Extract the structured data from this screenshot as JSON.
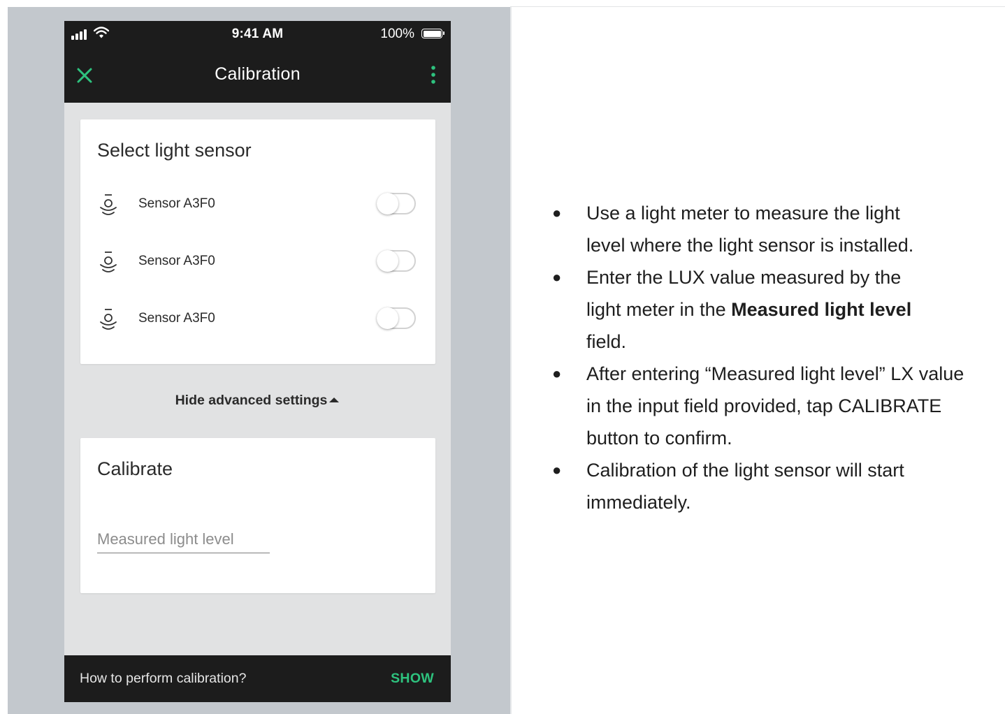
{
  "colors": {
    "accent": "#2ec27e",
    "dark_bar": "#1c1c1c",
    "screen_bg": "#e1e2e3",
    "panel_bg": "#c3c8cd"
  },
  "status_bar": {
    "time": "9:41 AM",
    "battery": "100%",
    "icons": [
      "signal-icon",
      "wifi-icon",
      "battery-icon"
    ]
  },
  "app_bar": {
    "title": "Calibration",
    "close_icon": "close-icon",
    "menu_icon": "more-vertical-icon"
  },
  "sensor_card": {
    "title": "Select light sensor",
    "sensors": [
      {
        "label": "Sensor A3F0",
        "icon": "light-sensor-icon",
        "enabled": false
      },
      {
        "label": "Sensor A3F0",
        "icon": "light-sensor-icon",
        "enabled": false
      },
      {
        "label": "Sensor A3F0",
        "icon": "light-sensor-icon",
        "enabled": false
      }
    ]
  },
  "advanced_toggle": {
    "label": "Hide advanced settings",
    "icon": "caret-up-icon"
  },
  "calibrate_card": {
    "title": "Calibrate",
    "input_placeholder": "Measured light level",
    "input_value": ""
  },
  "bottom_bar": {
    "text": "How to perform calibration?",
    "action": "SHOW"
  },
  "instructions": [
    {
      "parts": [
        {
          "text": "Use a light meter to measure the light",
          "bold": false
        },
        {
          "text": "level where the light sensor is installed.",
          "bold": false
        }
      ]
    },
    {
      "parts": [
        {
          "text": "Enter the LUX value measured by the",
          "bold": false
        },
        {
          "text": "light meter in the ",
          "bold": false
        },
        {
          "text": "Measured light level",
          "bold": true
        },
        {
          "text": "field.",
          "bold": false
        }
      ]
    },
    {
      "parts": [
        {
          "text": "After entering “Measured light level” LX value",
          "bold": false
        },
        {
          "text": "in the input field provided, tap CALIBRATE",
          "bold": false
        },
        {
          "text": "button to confirm.",
          "bold": false
        }
      ]
    },
    {
      "parts": [
        {
          "text": "Calibration of the light sensor will start",
          "bold": false
        },
        {
          "text": "immediately.",
          "bold": false
        }
      ]
    }
  ]
}
